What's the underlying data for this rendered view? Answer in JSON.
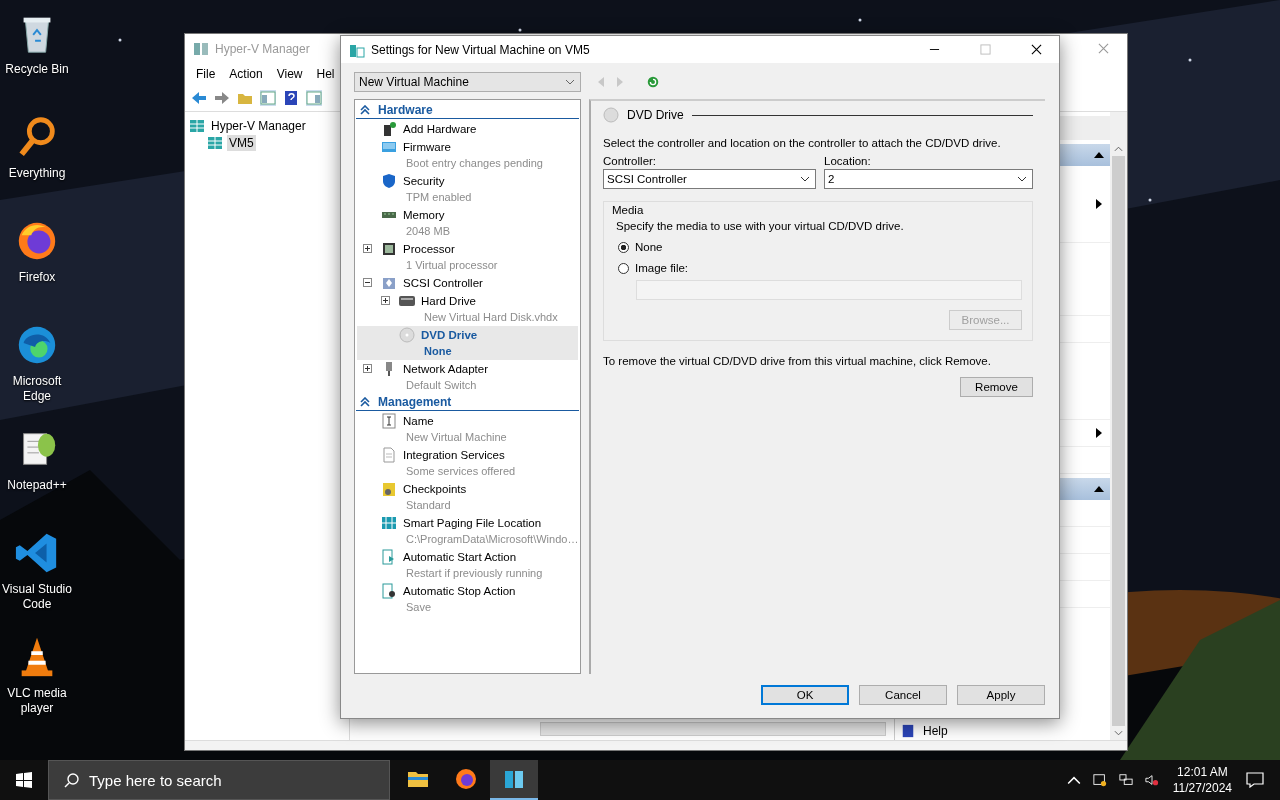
{
  "desktop_icons": [
    {
      "label": "Recycle Bin",
      "kind": "bin"
    },
    {
      "label": "Everything",
      "kind": "magnifier"
    },
    {
      "label": "Firefox",
      "kind": "firefox"
    },
    {
      "label": "Microsoft Edge",
      "kind": "edge"
    },
    {
      "label": "Notepad++",
      "kind": "notepad"
    },
    {
      "label": "Visual Studio Code",
      "kind": "vscode"
    },
    {
      "label": "VLC media player",
      "kind": "vlc"
    }
  ],
  "manager": {
    "title": "Hyper-V Manager",
    "menu": [
      "File",
      "Action",
      "View",
      "Hel"
    ],
    "tree": [
      {
        "label": "Hyper-V Manager",
        "selected": false,
        "children": [
          {
            "label": "VM5",
            "selected": true
          }
        ]
      }
    ],
    "help": "Help"
  },
  "dialog": {
    "title": "Settings for New Virtual Machine on VM5",
    "vm_select": "New Virtual Machine",
    "sections": [
      {
        "title": "Hardware",
        "items": [
          {
            "name": "Add Hardware",
            "kind": "addhw",
            "selected": false
          },
          {
            "name": "Firmware",
            "detail": "Boot entry changes pending",
            "kind": "firmware",
            "selected": false
          },
          {
            "name": "Security",
            "detail": "TPM enabled",
            "kind": "shield",
            "selected": false
          },
          {
            "name": "Memory",
            "detail": "2048 MB",
            "kind": "memory",
            "selected": false
          },
          {
            "name": "Processor",
            "detail": "1 Virtual processor",
            "kind": "chip",
            "selected": false,
            "expanded": false
          },
          {
            "name": "SCSI Controller",
            "kind": "controller",
            "selected": false,
            "expanded": true,
            "children": [
              {
                "name": "Hard Drive",
                "detail": "New Virtual Hard Disk.vhdx",
                "kind": "disk",
                "selected": false,
                "expanded": false
              },
              {
                "name": "DVD Drive",
                "detail": "None",
                "kind": "disc",
                "selected": true
              }
            ]
          },
          {
            "name": "Network Adapter",
            "detail": "Default Switch",
            "kind": "network",
            "selected": false,
            "expanded": false
          }
        ]
      },
      {
        "title": "Management",
        "items": [
          {
            "name": "Name",
            "detail": "New Virtual Machine",
            "kind": "name",
            "selected": false
          },
          {
            "name": "Integration Services",
            "detail": "Some services offered",
            "kind": "document",
            "selected": false
          },
          {
            "name": "Checkpoints",
            "detail": "Standard",
            "kind": "checkpoint",
            "selected": false
          },
          {
            "name": "Smart Paging File Location",
            "detail": "C:\\ProgramData\\Microsoft\\Windo…",
            "kind": "paging",
            "selected": false
          },
          {
            "name": "Automatic Start Action",
            "detail": "Restart if previously running",
            "kind": "start",
            "selected": false
          },
          {
            "name": "Automatic Stop Action",
            "detail": "Save",
            "kind": "stop",
            "selected": false
          }
        ]
      }
    ],
    "panel": {
      "heading": "DVD Drive",
      "description": "Select the controller and location on the controller to attach the CD/DVD drive.",
      "controller_label": "Controller:",
      "controller": "SCSI Controller",
      "location_label": "Location:",
      "location": "2",
      "media_title": "Media",
      "media_text": "Specify the media to use with your virtual CD/DVD drive.",
      "media_options": [
        {
          "label": "None",
          "selected": true
        },
        {
          "label": "Image file:",
          "selected": false
        }
      ],
      "browse": {
        "label": "Browse...",
        "disabled": true
      },
      "remove_text": "To remove the virtual CD/DVD drive from this virtual machine, click Remove.",
      "remove": "Remove"
    },
    "buttons": [
      {
        "label": "OK",
        "default": true
      },
      {
        "label": "Cancel",
        "default": false
      },
      {
        "label": "Apply",
        "default": false
      }
    ]
  },
  "taskbar": {
    "search_placeholder": "Type here to search",
    "time": "12:01 AM",
    "date": "11/27/2024"
  }
}
